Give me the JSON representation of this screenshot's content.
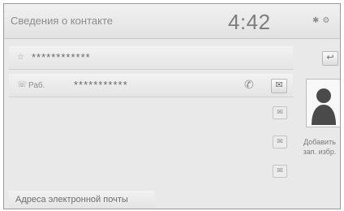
{
  "header": {
    "title": "Сведения о контакте",
    "time": "4:42",
    "status_icons": [
      "bluetooth-icon",
      "settings-icon"
    ]
  },
  "contact": {
    "name_value": "************",
    "phone_type": "Раб.",
    "phone_value": "***********"
  },
  "buttons": {
    "back_symbol": "↩",
    "message_symbol": "✉",
    "side_symbol": "✉"
  },
  "side": {
    "add_label": "Добавить зап. избр."
  },
  "footer": {
    "email_label": "Адреса электронной почты"
  }
}
